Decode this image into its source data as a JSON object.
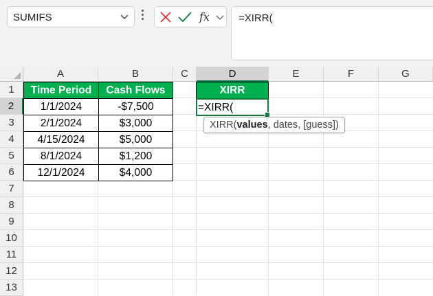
{
  "name_box": {
    "value": "SUMIFS"
  },
  "formula_bar": {
    "value": "=XIRR("
  },
  "columns": [
    "A",
    "B",
    "C",
    "D",
    "E",
    "F",
    "G"
  ],
  "rows": [
    "1",
    "2",
    "3",
    "4",
    "5",
    "6",
    "7",
    "8",
    "9",
    "10",
    "11",
    "12",
    "13"
  ],
  "active": {
    "column": "D",
    "row": "2"
  },
  "table": {
    "headers": [
      "Time Period",
      "Cash Flows"
    ],
    "rows": [
      [
        "1/1/2024",
        "-$7,500"
      ],
      [
        "2/1/2024",
        "$3,000"
      ],
      [
        "4/15/2024",
        "$5,000"
      ],
      [
        "8/1/2024",
        "$1,200"
      ],
      [
        "12/1/2024",
        "$4,000"
      ]
    ]
  },
  "xirr_header": "XIRR",
  "editing_cell": {
    "value": "=XIRR("
  },
  "tooltip": {
    "func": "XIRR(",
    "arg_current": "values",
    "rest": ", dates, [guess])"
  },
  "colors": {
    "header_fill": "#00b050",
    "selection_accent": "#107c41",
    "cancel_icon": "#d13438",
    "enter_icon": "#107c41"
  },
  "icons": [
    "chevron-down-icon",
    "more-options-icon",
    "cancel-icon",
    "enter-icon",
    "insert-function-icon"
  ]
}
